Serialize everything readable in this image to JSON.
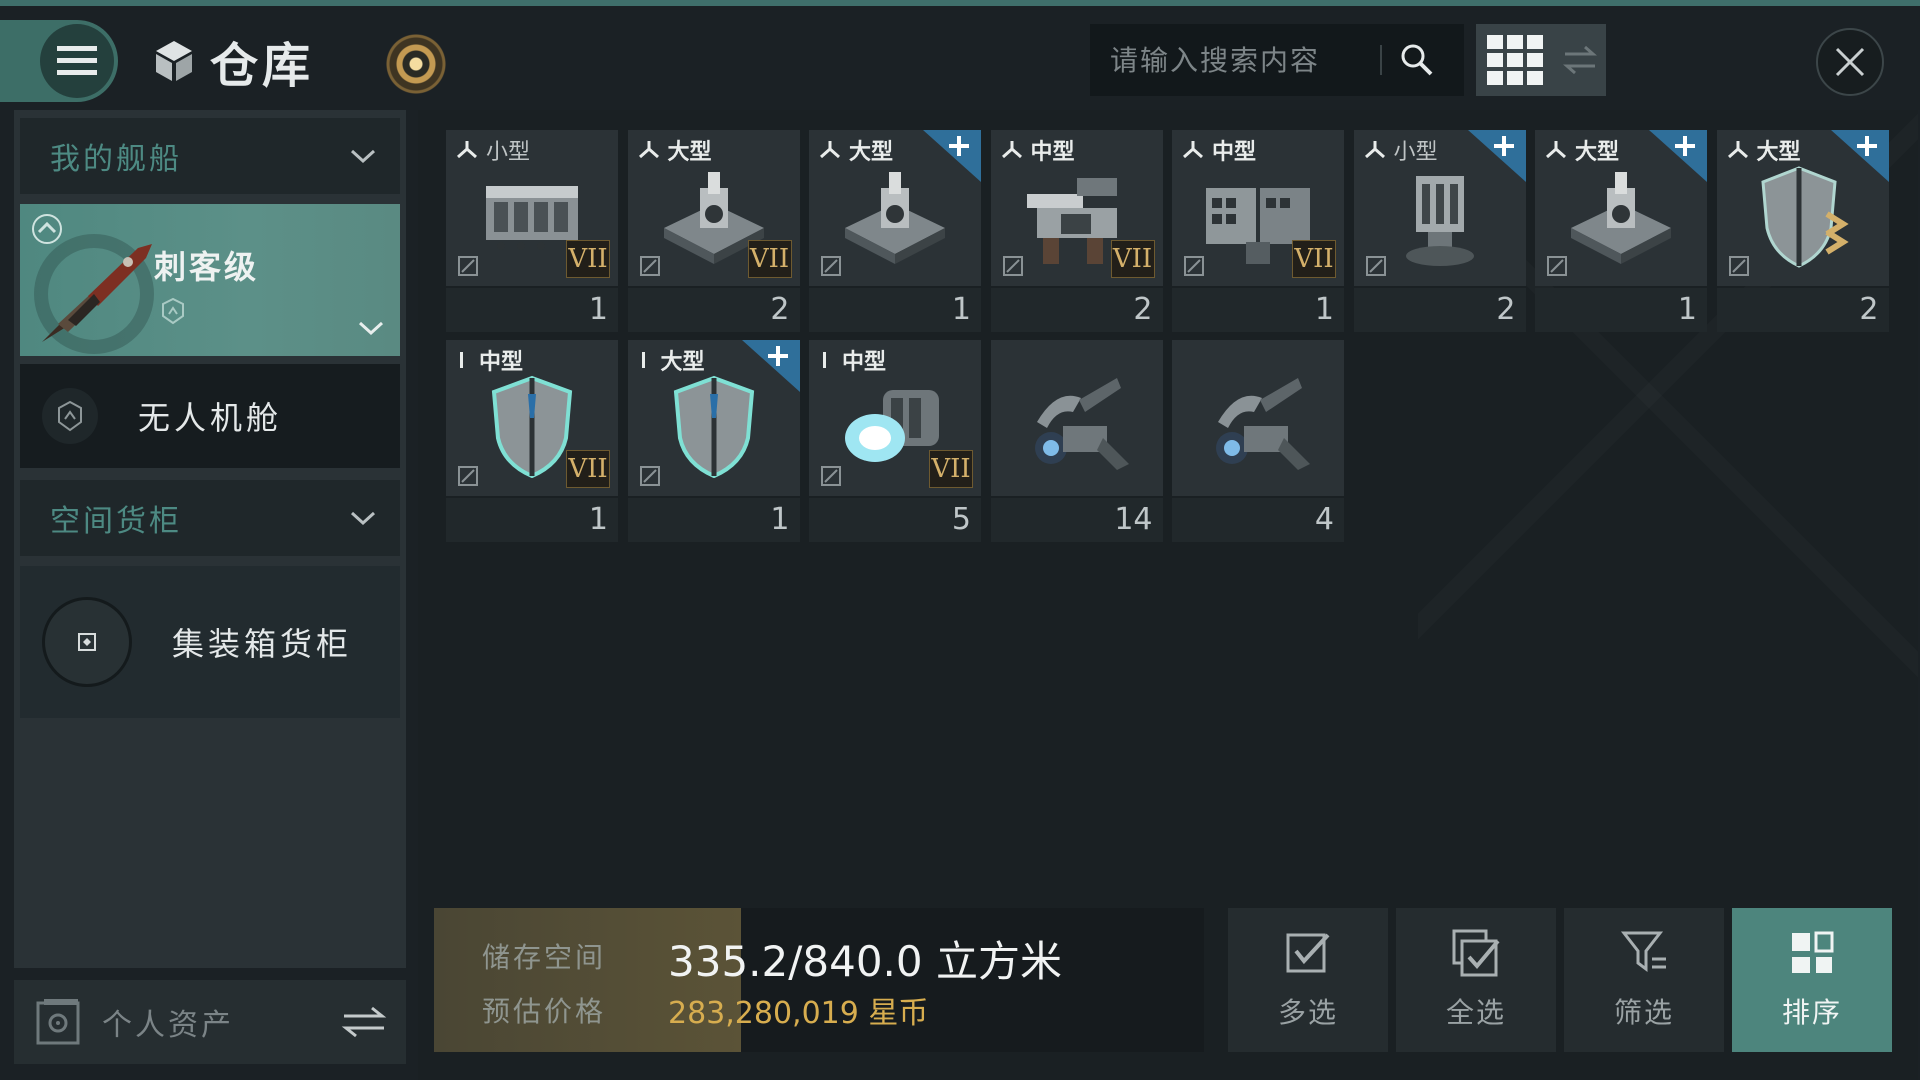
{
  "header": {
    "title": "仓库",
    "search_placeholder": "请输入搜索内容"
  },
  "sidebar": {
    "section_ships": "我的舰船",
    "ship_name": "刺客级",
    "drone_bay": "无人机舱",
    "section_cargo": "空间货柜",
    "container_cargo": "集装箱货柜",
    "assets": "个人资产"
  },
  "items": [
    {
      "size": "小型",
      "size_style": "light",
      "badge": "turret",
      "tier": "VII",
      "count": "1",
      "plus": false,
      "art": "launcher"
    },
    {
      "size": "大型",
      "size_style": "bold",
      "badge": "turret",
      "tier": "VII",
      "count": "2",
      "plus": false,
      "art": "platform"
    },
    {
      "size": "大型",
      "size_style": "bold",
      "badge": "turret",
      "tier": "",
      "count": "1",
      "plus": true,
      "art": "platform"
    },
    {
      "size": "中型",
      "size_style": "bold",
      "badge": "turret",
      "tier": "VII",
      "count": "2",
      "plus": false,
      "art": "cannon"
    },
    {
      "size": "中型",
      "size_style": "bold",
      "badge": "turret",
      "tier": "VII",
      "count": "1",
      "plus": false,
      "art": "rocket"
    },
    {
      "size": "小型",
      "size_style": "light",
      "badge": "turret",
      "tier": "",
      "count": "2",
      "plus": true,
      "art": "tower"
    },
    {
      "size": "大型",
      "size_style": "bold",
      "badge": "turret",
      "tier": "",
      "count": "1",
      "plus": true,
      "art": "platform"
    },
    {
      "size": "大型",
      "size_style": "bold",
      "badge": "turret",
      "tier": "",
      "count": "2",
      "plus": true,
      "art": "shield-gold"
    },
    {
      "size": "中型",
      "size_style": "bold",
      "badge": "bar",
      "tier": "VII",
      "count": "1",
      "plus": false,
      "art": "shield"
    },
    {
      "size": "大型",
      "size_style": "bold",
      "badge": "bar",
      "tier": "",
      "count": "1",
      "plus": true,
      "art": "shield"
    },
    {
      "size": "中型",
      "size_style": "bold",
      "badge": "bar",
      "tier": "VII",
      "count": "5",
      "plus": false,
      "art": "thruster"
    },
    {
      "size": "",
      "size_style": "bold",
      "badge": "none",
      "tier": "",
      "count": "14",
      "plus": false,
      "art": "drone"
    },
    {
      "size": "",
      "size_style": "bold",
      "badge": "none",
      "tier": "",
      "count": "4",
      "plus": false,
      "art": "drone"
    }
  ],
  "storage": {
    "label_space": "储存空间",
    "space_value": "335.2/840.0 立方米",
    "fill_fraction": 0.399,
    "label_price": "预估价格",
    "price_value": "283,280,019 星币"
  },
  "actions": [
    {
      "label": "多选",
      "icon": "checkbox-icon"
    },
    {
      "label": "全选",
      "icon": "select-all-icon"
    },
    {
      "label": "筛选",
      "icon": "filter-icon"
    },
    {
      "label": "排序",
      "icon": "sort-icon",
      "active": true
    }
  ],
  "colors": {
    "accent_teal": "#4d857d",
    "tier_gold": "#d4b06a",
    "price_gold": "#d7ad4f",
    "plus_blue": "#2f6f9a"
  }
}
